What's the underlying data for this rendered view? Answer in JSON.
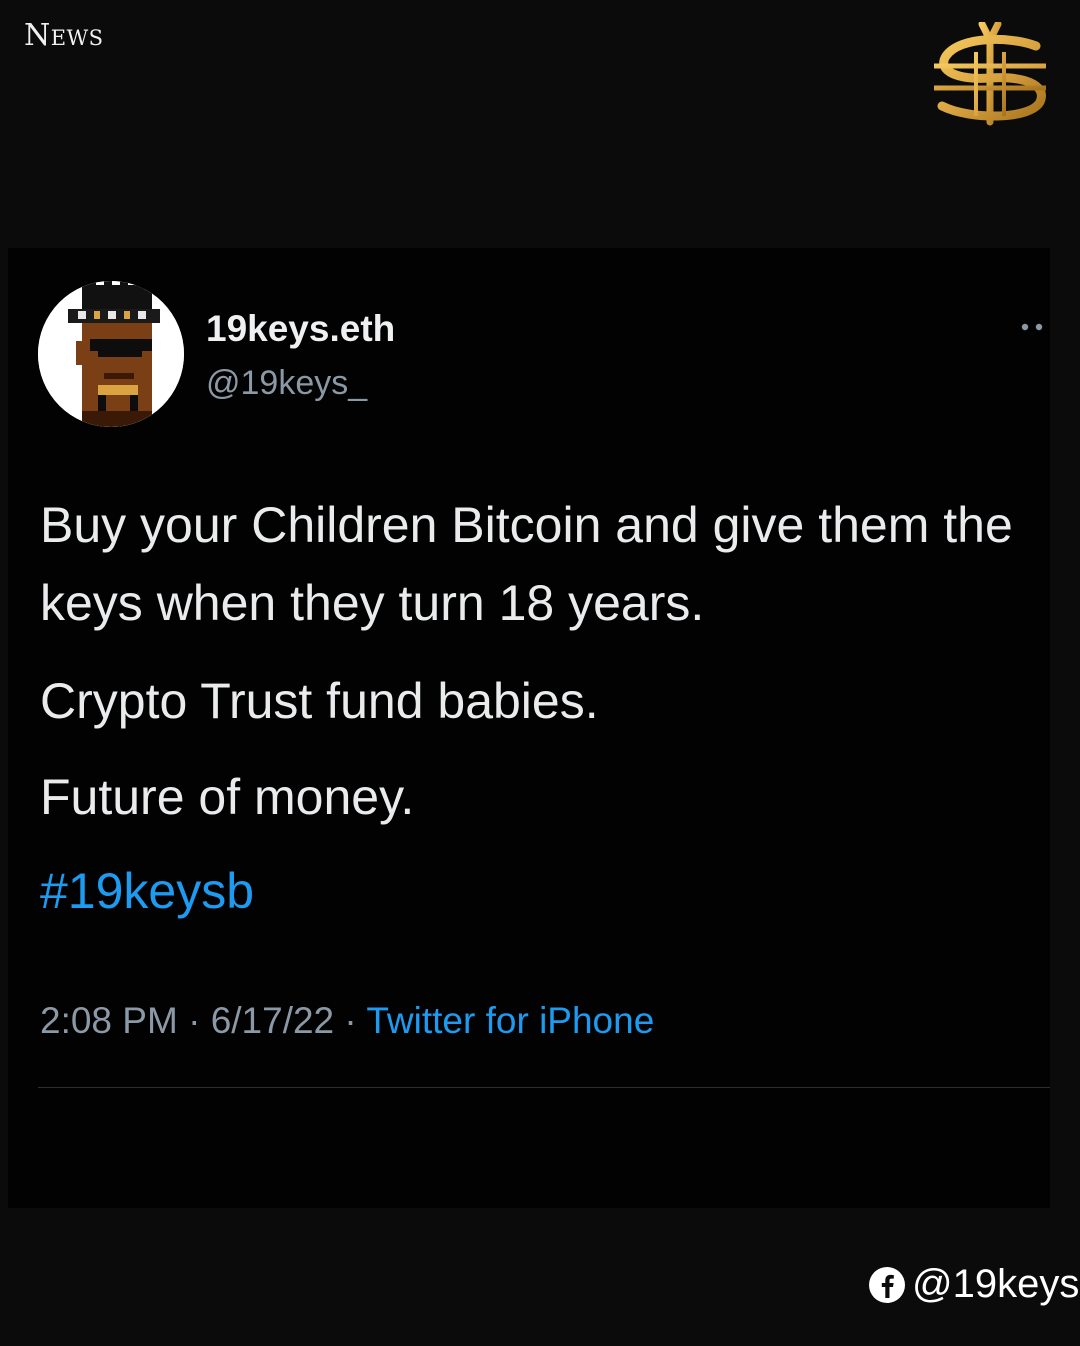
{
  "header": {
    "section_label": "News",
    "logo_icon": "gold-dollar-sign-logo",
    "logo_color": "#d9a441"
  },
  "tweet": {
    "display_name": "19keys.eth",
    "handle": "@19keys_",
    "avatar_icon": "pixel-art-avatar",
    "more_icon": "more-options-icon",
    "body": {
      "line_1": "Buy your Children Bitcoin and give them the keys when they turn 18 years.",
      "line_2": "Crypto Trust fund babies.",
      "line_3": "Future of money.",
      "hashtag": "#19keysb"
    },
    "meta": {
      "time": "2:08 PM",
      "separator": "·",
      "date": "6/17/22",
      "source": "Twitter for iPhone"
    },
    "colors": {
      "link": "#1d9bf0",
      "secondary_text": "#8b98a5",
      "primary_text": "#e9ebed"
    }
  },
  "footer": {
    "social_icon": "facebook-icon",
    "social_handle": "@19keys"
  }
}
